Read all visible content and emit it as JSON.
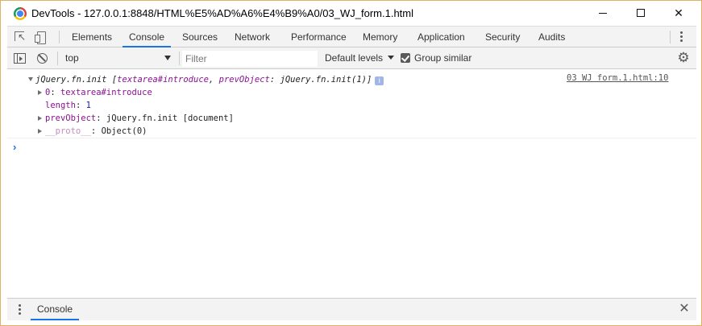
{
  "window": {
    "title": "DevTools - 127.0.0.1:8848/HTML%E5%AD%A6%E4%B9%A0/03_WJ_form.1.html",
    "min_glyph": "—",
    "max_glyph": "☐",
    "close_glyph": "✕"
  },
  "tabs": [
    {
      "label": "Elements"
    },
    {
      "label": "Console",
      "active": true
    },
    {
      "label": "Sources"
    },
    {
      "label": "Network"
    },
    {
      "label": "Performance"
    },
    {
      "label": "Memory"
    },
    {
      "label": "Application"
    },
    {
      "label": "Security"
    },
    {
      "label": "Audits"
    }
  ],
  "toolbar": {
    "context": "top",
    "filter_placeholder": "Filter",
    "levels_label": "Default levels",
    "group_similar_label": "Group similar",
    "group_similar_checked": true
  },
  "console": {
    "message": {
      "summary_name": "jQuery.fn.init",
      "summary_open": " [",
      "summary_item0": "textarea#introduce",
      "summary_sep": ", ",
      "summary_prev_key": "prevObject",
      "summary_prev_colon": ": ",
      "summary_prev_val": "jQuery.fn.init(1)",
      "summary_close": "]",
      "info_glyph": "i",
      "source": "03 WJ form.1.html:10",
      "props": {
        "p0_key": "0",
        "p0_val": "textarea#introduce",
        "length_key": "length",
        "length_val": "1",
        "prev_key": "prevObject",
        "prev_val": "jQuery.fn.init [document]",
        "proto_key": "__proto__",
        "proto_val": "Object(0)",
        "colon": ": "
      }
    },
    "prompt": "›"
  },
  "drawer": {
    "tab_label": "Console",
    "close_glyph": "✕"
  },
  "colors": {
    "accent": "#1a73e8",
    "window_border": "#e2b064",
    "property_key": "#881391",
    "number_value": "#1a1aa6"
  },
  "icons": [
    "chrome-logo-icon",
    "inspect-element-icon",
    "device-toolbar-icon",
    "more-options-icon",
    "sidebar-toggle-icon",
    "clear-console-icon",
    "settings-gear-icon",
    "info-icon",
    "close-icon"
  ]
}
